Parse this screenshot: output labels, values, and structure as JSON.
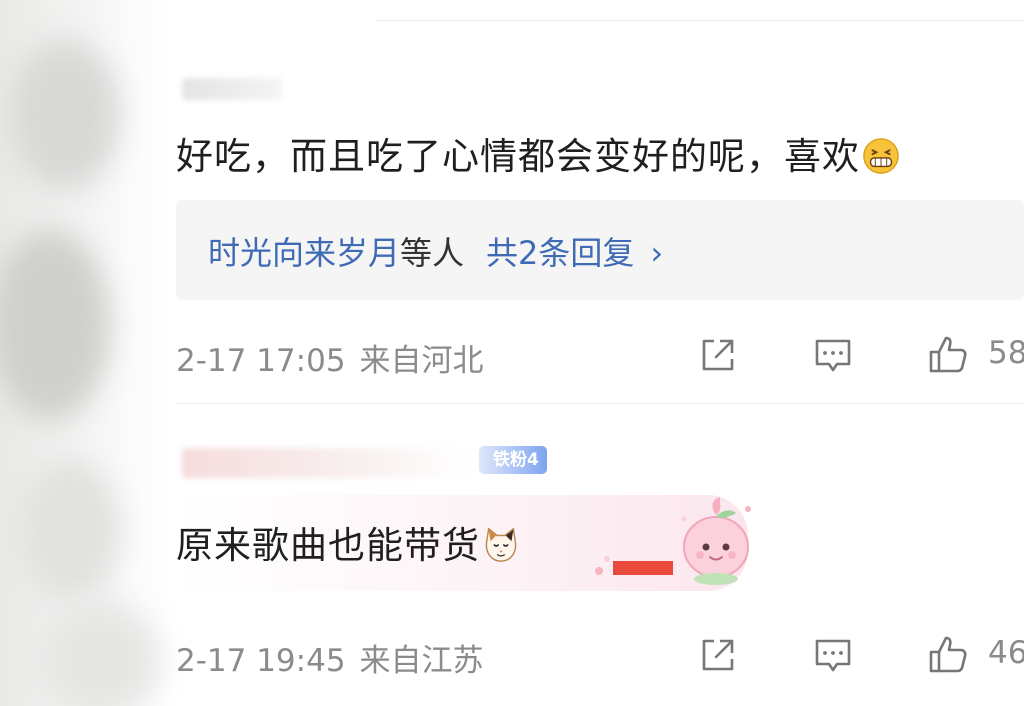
{
  "comments": [
    {
      "text": "好吃，而且吃了心情都会变好的呢，喜欢",
      "emoji_icon": "grinning-face-icon",
      "replies": {
        "names": "时光向来岁月",
        "suffix": "等人",
        "count_label": "共2条回复",
        "chevron": "›"
      },
      "timestamp": "2-17 17:05",
      "location": "来自河北",
      "like_count": "58"
    },
    {
      "badge": "铁粉4",
      "text": "原来歌曲也能带货",
      "emoji_icon": "cat-face-icon",
      "timestamp": "2-17 19:45",
      "location": "来自江苏",
      "like_count": "46"
    }
  ],
  "colors": {
    "reply_link": "#3f6bb5",
    "meta_text": "#8b8b8b",
    "badge": "#7ea4ef"
  }
}
